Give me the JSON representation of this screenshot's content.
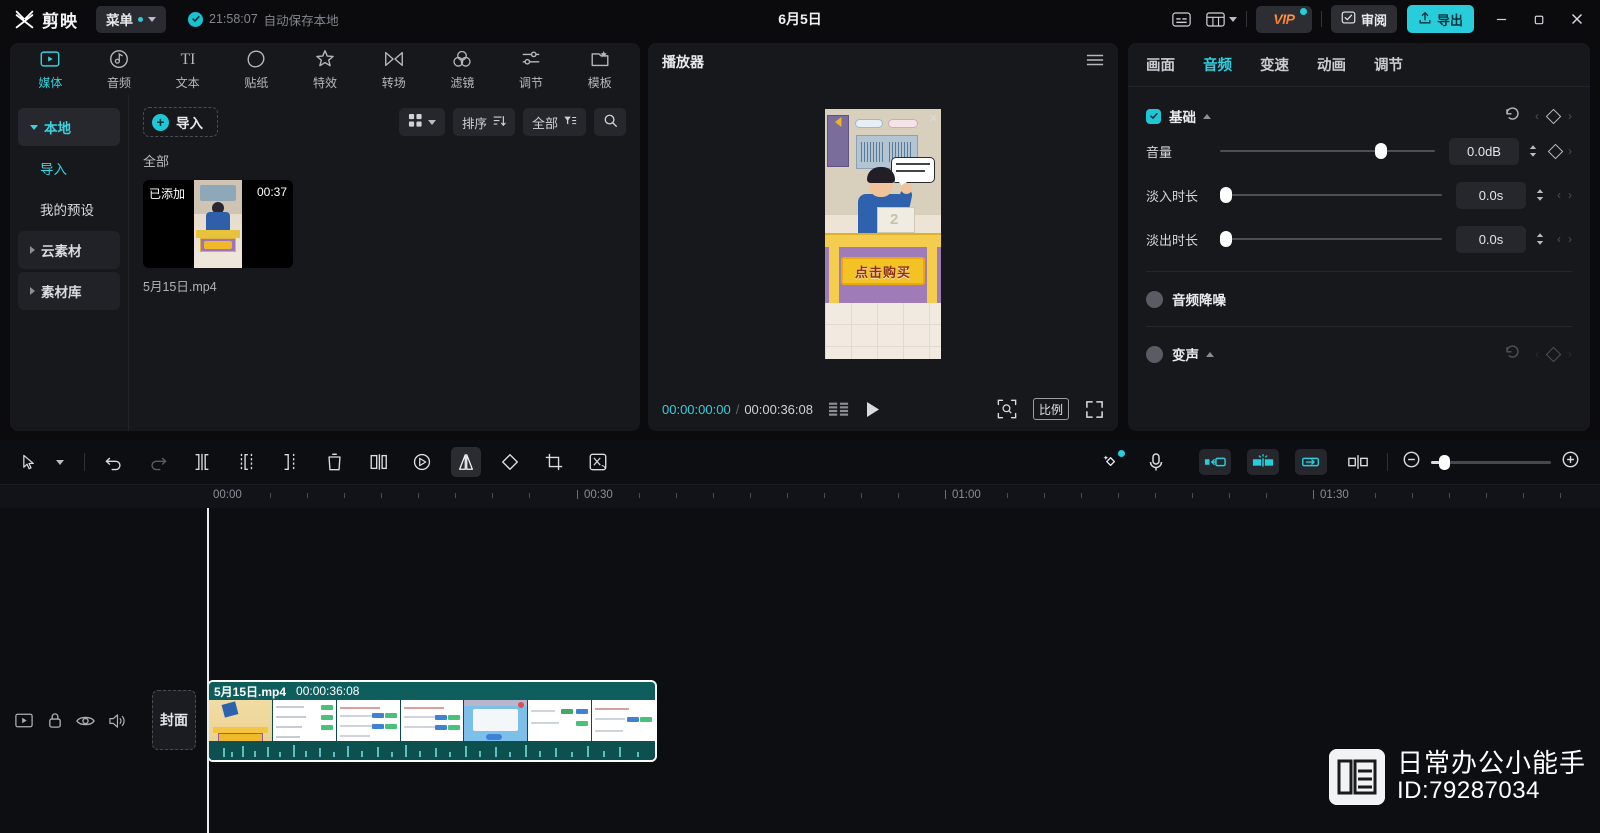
{
  "app": {
    "brand": "剪映",
    "menu_label": "菜单",
    "autosave_time": "21:58:07",
    "autosave_text": "自动保存本地",
    "project_date": "6月5日",
    "vip_label": "VIP",
    "review_label": "审阅",
    "export_label": "导出"
  },
  "left_tabs": [
    {
      "label": "媒体",
      "icon": "media-icon",
      "active": true
    },
    {
      "label": "音频",
      "icon": "audio-icon",
      "active": false
    },
    {
      "label": "文本",
      "icon": "text-icon",
      "active": false
    },
    {
      "label": "贴纸",
      "icon": "sticker-icon",
      "active": false
    },
    {
      "label": "特效",
      "icon": "effects-icon",
      "active": false
    },
    {
      "label": "转场",
      "icon": "transition-icon",
      "active": false
    },
    {
      "label": "滤镜",
      "icon": "filter-icon",
      "active": false
    },
    {
      "label": "调节",
      "icon": "adjust-icon",
      "active": false
    },
    {
      "label": "模板",
      "icon": "template-icon",
      "active": false
    }
  ],
  "library": {
    "nav": [
      {
        "label": "本地",
        "type": "selected"
      },
      {
        "label": "导入",
        "type": "link"
      },
      {
        "label": "我的预设",
        "type": "plain"
      },
      {
        "label": "云素材",
        "type": "group"
      },
      {
        "label": "素材库",
        "type": "group"
      }
    ],
    "import_label": "导入",
    "sort_label": "排序",
    "filter_label": "全部",
    "category_label": "全部",
    "media": [
      {
        "name": "5月15日.mp4",
        "duration": "00:37",
        "state": "已添加"
      }
    ]
  },
  "player": {
    "title": "播放器",
    "current_time": "00:00:00:00",
    "total_time": "00:00:36:08",
    "ratio_label": "比例",
    "video_cta": "点击购买",
    "card_number": "2"
  },
  "properties": {
    "tabs": [
      {
        "label": "画面",
        "active": false
      },
      {
        "label": "音频",
        "active": true
      },
      {
        "label": "变速",
        "active": false
      },
      {
        "label": "动画",
        "active": false
      },
      {
        "label": "调节",
        "active": false
      }
    ],
    "basic_section": "基础",
    "rows": [
      {
        "label": "音量",
        "value": "0.0dB",
        "knob_pct": 73
      },
      {
        "label": "淡入时长",
        "value": "0.0s",
        "knob_pct": 0
      },
      {
        "label": "淡出时长",
        "value": "0.0s",
        "knob_pct": 0
      }
    ],
    "denoise_label": "音频降噪",
    "voice_label": "变声"
  },
  "timeline": {
    "ruler_labels": [
      "00:00",
      "00:30",
      "01:00",
      "01:30"
    ],
    "cover_label": "封面",
    "clip": {
      "name": "5月15日.mp4",
      "duration": "00:00:36:08"
    }
  },
  "watermark": {
    "line1": "日常办公小能手",
    "line2": "ID:79287034"
  },
  "colors": {
    "accent": "#2fd0de",
    "export_bg": "#28cddb",
    "clip_bg": "#0c5c5c",
    "panel_bg": "#17181c",
    "window_bg": "#0b0b0d"
  }
}
